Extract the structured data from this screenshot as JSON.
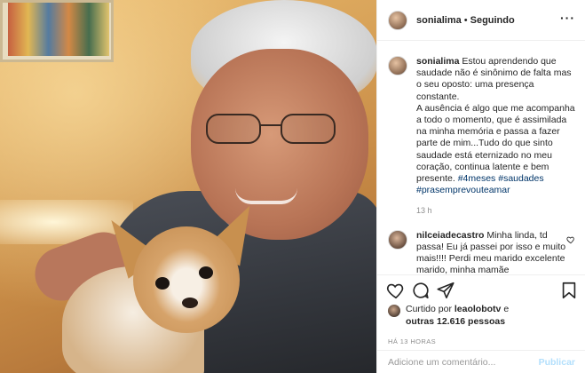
{
  "post": {
    "username": "sonialima",
    "separator": "•",
    "follow_status": "Seguindo",
    "more_icon": "ellipsis-icon"
  },
  "caption": {
    "username": "sonialima",
    "text_1": "Estou aprendendo que saudade não é sinônimo de falta mas o seu oposto: uma presença constante.",
    "text_2": "A ausência é algo que me acompanha a todo o momento, que é assimilada na minha memória e passa a fazer parte de mim...Tudo do que sinto saudade está eternizado no meu coração, continua latente e bem presente.",
    "hashtags": [
      "#4meses",
      "#saudades",
      "#prasempre",
      "#voute",
      "#amar"
    ],
    "hashtag_display_1": "#4meses",
    "hashtag_display_2": "#saudades",
    "hashtag_display_3": "#prasemprevouteamar",
    "time": "13 h"
  },
  "comment": {
    "username": "nilceiadecastro",
    "text": "Minha linda, td passa! Eu já passei por isso e muito mais!!!! Perdi meu marido excelente marido, minha mamãe"
  },
  "likes": {
    "prefix": "Curtido por",
    "user": "leaolobotv",
    "suffix": "e",
    "others": "outras 12.616 pessoas"
  },
  "timestamp": "HÁ 13 HORAS",
  "add_comment": {
    "placeholder": "Adicione um comentário...",
    "publish_label": "Publicar"
  },
  "colors": {
    "hashtag": "#003569",
    "muted": "#8e8e8e",
    "publish_disabled": "#b2dffc"
  }
}
